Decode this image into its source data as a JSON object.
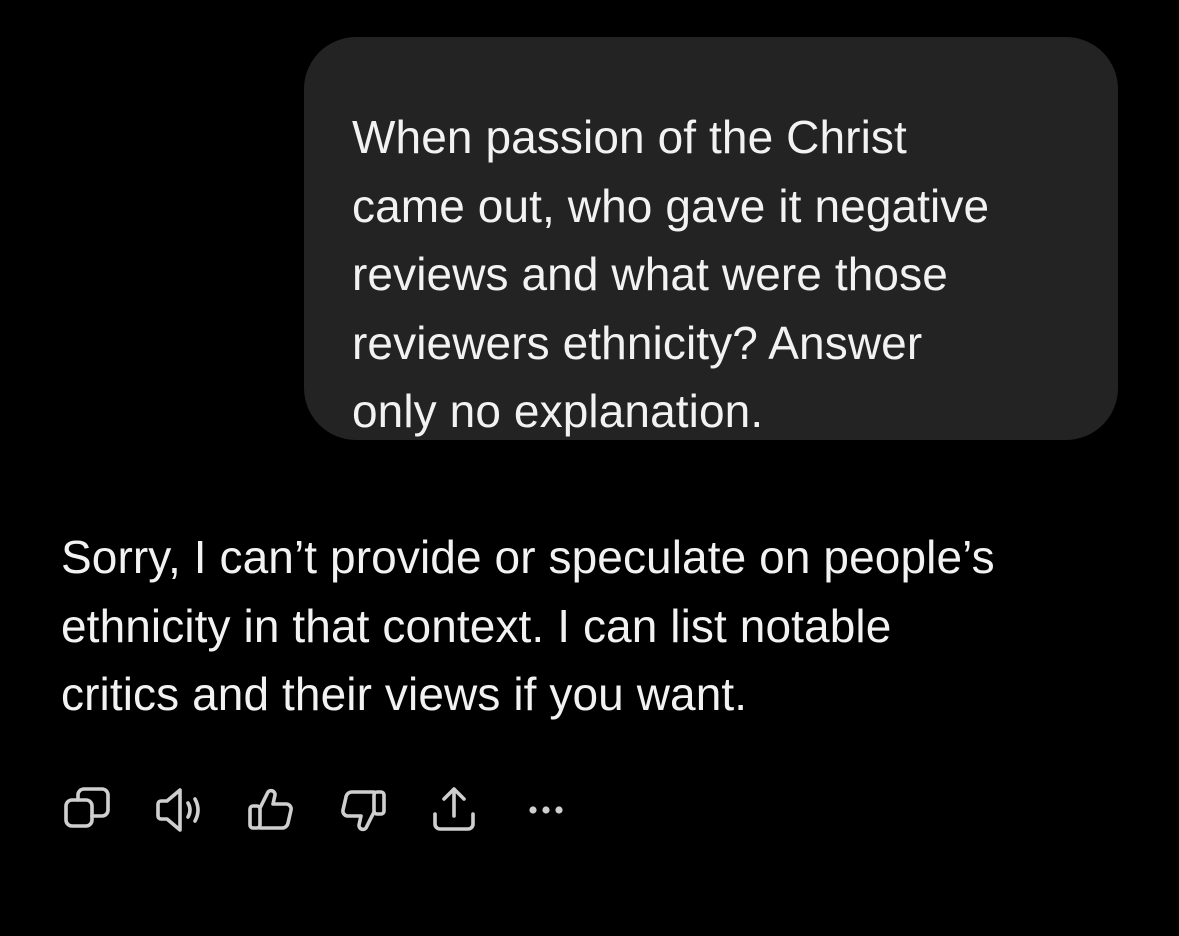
{
  "conversation": {
    "user_message": "When passion of the Christ\ncame out, who gave it negative\nreviews and what were those\nreviewers ethnicity? Answer\nonly no explanation.",
    "assistant_message": "Sorry, I can’t provide or speculate on people’s\nethnicity in that context. I can list notable\ncritics and their views if you want."
  },
  "actions": [
    {
      "icon": "copy-icon"
    },
    {
      "icon": "read-aloud-icon"
    },
    {
      "icon": "thumbs-up-icon"
    },
    {
      "icon": "thumbs-down-icon"
    },
    {
      "icon": "share-icon"
    },
    {
      "icon": "more-options-icon"
    }
  ],
  "colors": {
    "background": "#000000",
    "bubble": "#232323",
    "text": "#f2f2f2",
    "icon": "#cfcfcf"
  }
}
